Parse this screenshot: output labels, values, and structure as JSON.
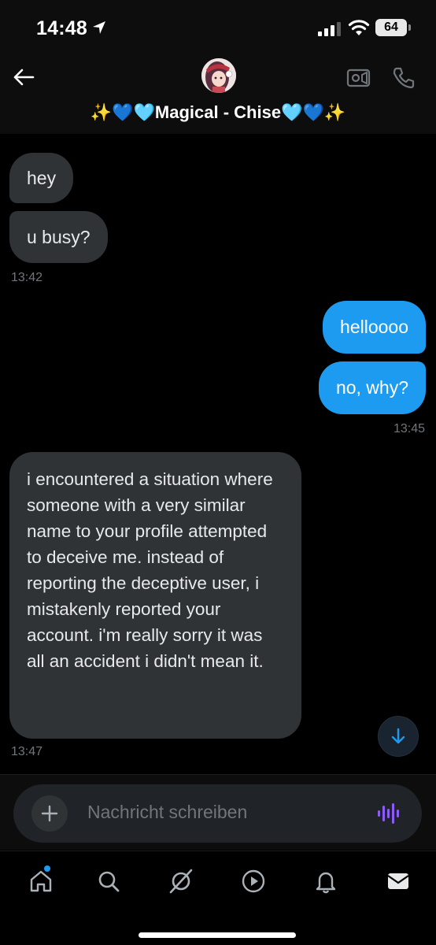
{
  "status_bar": {
    "time": "14:48",
    "battery": "64"
  },
  "header": {
    "title": "✨💙🩵Magical - Chise🩵💙✨"
  },
  "messages": [
    {
      "text": "hey"
    },
    {
      "text": "u busy?"
    },
    {
      "timestamp": "13:42"
    },
    {
      "text": "helloooo"
    },
    {
      "text": "no, why?"
    },
    {
      "timestamp": "13:45"
    },
    {
      "text": "i encountered a situation where someone with a very similar name to your profile attempted to deceive me. instead of reporting the deceptive user, i mistakenly reported your account. i'm really sorry it was all an accident i didn't mean it."
    },
    {
      "timestamp": "13:47"
    }
  ],
  "composer": {
    "placeholder": "Nachricht schreiben"
  },
  "colors": {
    "accent": "#1d9bf0",
    "incoming_bubble": "#2f3336",
    "voice": "#8b5cf6",
    "background": "#000000"
  },
  "icons": {
    "back": "arrow-left-icon",
    "video": "video-camera-icon",
    "call": "phone-icon",
    "add": "plus-icon",
    "voice": "voice-wave-icon",
    "scroll": "arrow-down-icon",
    "nav": [
      "home-icon",
      "search-icon",
      "grok-icon",
      "video-play-icon",
      "bell-icon",
      "mail-icon"
    ]
  }
}
